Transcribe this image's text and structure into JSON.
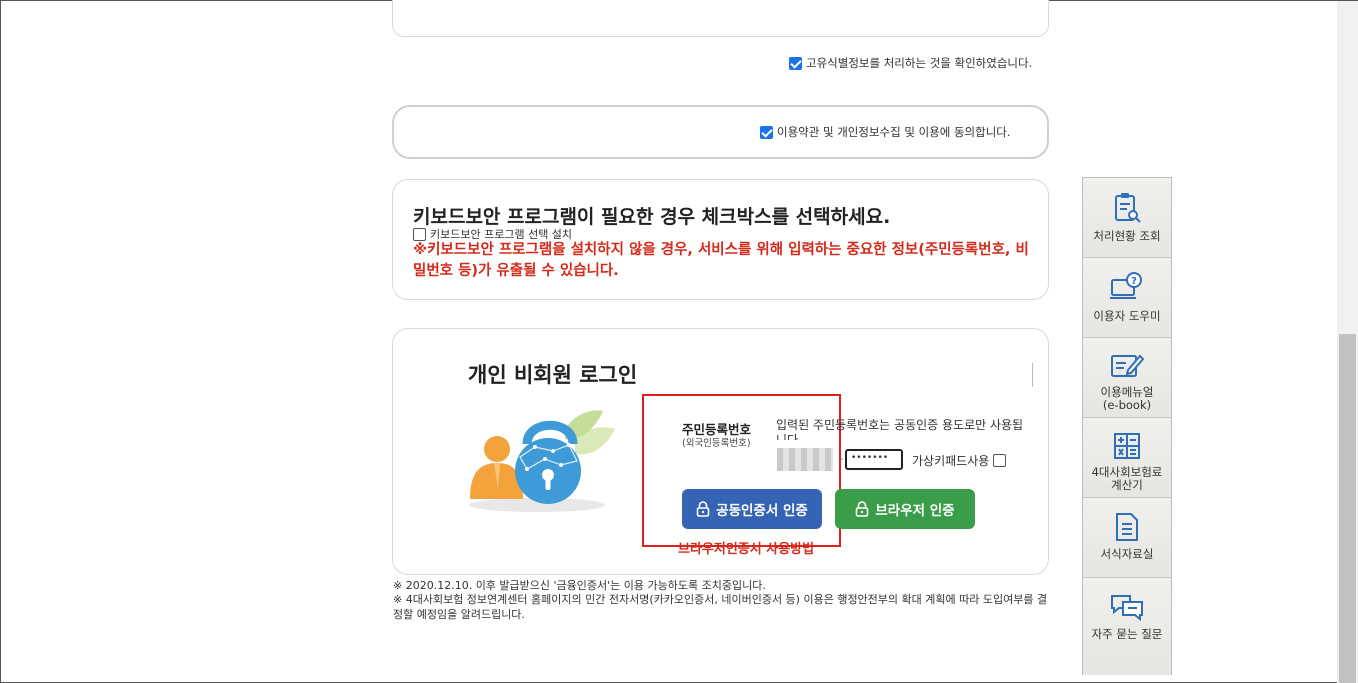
{
  "agreement": {
    "unique_id_confirm": "고유식별정보를 처리하는 것을 확인하였습니다.",
    "terms_agree": "이용약관 및 개인정보수집 및 이용에 동의합니다."
  },
  "keyboard_security": {
    "title": "키보드보안 프로그램이 필요한 경우 체크박스를 선택하세요.",
    "checkbox_label": "키보드보안 프로그램 선택 설치",
    "warning": "※키보드보안 프로그램을 설치하지 않을 경우, 서비스를 위해 입력하는 중요한 정보(주민등록번호, 비밀번호 등)가 유출될 수 있습니다."
  },
  "login": {
    "title": "개인 비회원 로그인",
    "rrn_label": "주민등록번호",
    "rrn_sub_label": "(외국인등록번호)",
    "rrn_notice": "입력된 주민등록번호는 공동인증 용도로만 사용됩니다.",
    "rrn_dash": "-",
    "rrn_masked": "•••••••",
    "virtual_keypad_label": "가상키패드사용",
    "cert_button": "공동인증서 인증",
    "browser_button": "브라우저 인증",
    "browser_howto": "브라우저인증서 사용방법"
  },
  "notes": {
    "note1": "※ 2020.12.10. 이후 발급받으신 '금융인증서'는 이용 가능하도록 조치중입니다.",
    "note2": "※ 4대사회보험 정보연계센터 홈페이지의 민간 전자서명(카카오인증서, 네이버인증서 등) 이용은 행정안전부의 확대 계획에 따라 도입여부를 결정할 예정임을 알려드립니다."
  },
  "quick_menu": [
    {
      "label": "처리현황 조회",
      "icon": "clipboard-search-icon"
    },
    {
      "label": "이용자 도우미",
      "icon": "monitor-question-icon"
    },
    {
      "label": "이용메뉴얼\n(e-book)",
      "icon": "edit-doc-icon"
    },
    {
      "label": "4대사회보험료\n계산기",
      "icon": "calculator-icon"
    },
    {
      "label": "서식자료실",
      "icon": "document-list-icon"
    },
    {
      "label": "자주 묻는 질문",
      "icon": "chat-bubbles-icon"
    }
  ],
  "colors": {
    "accent_blue": "#3564b4",
    "accent_green": "#3a9d4a",
    "warning_red": "#d42a1b",
    "icon_blue": "#2f6fb8"
  }
}
